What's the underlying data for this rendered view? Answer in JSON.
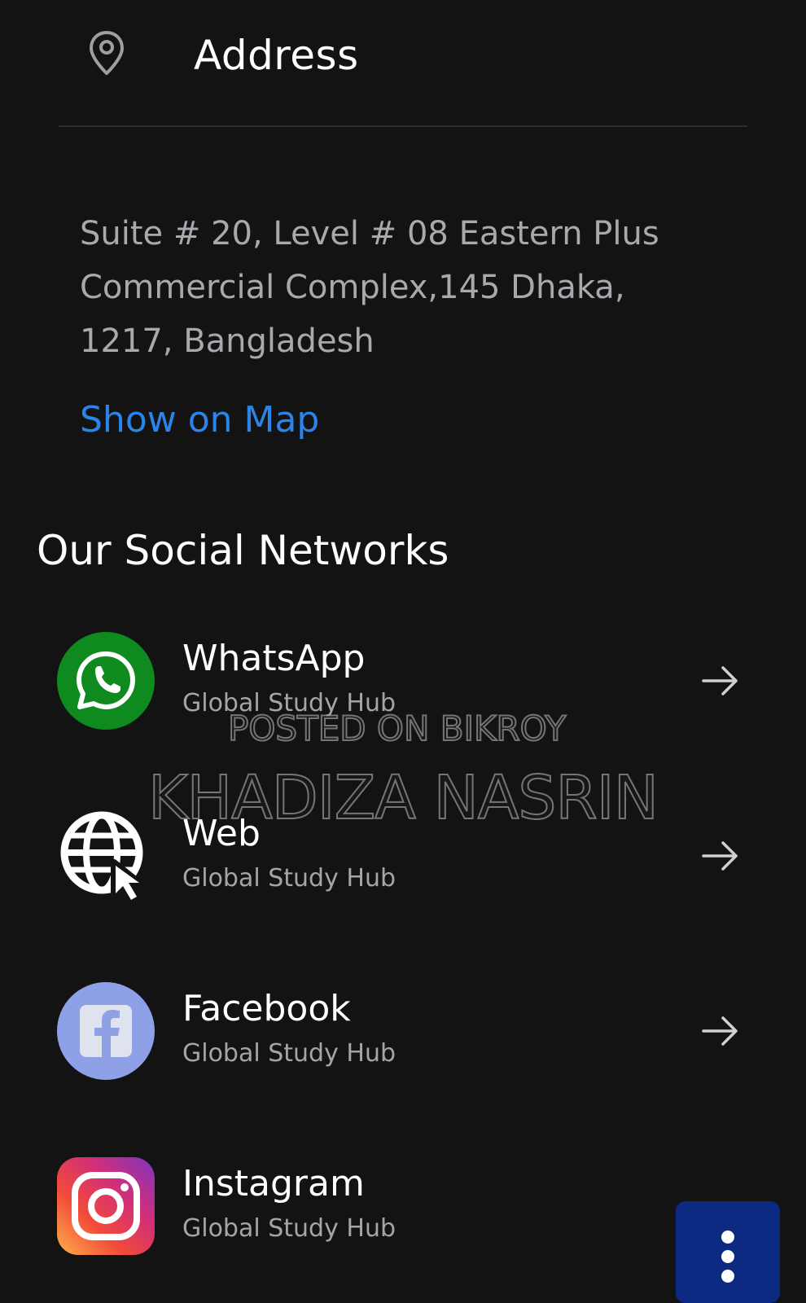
{
  "address": {
    "icon": "map-pin-icon",
    "title": "Address",
    "text": "Suite # 20, Level # 08 Eastern Plus Commercial Complex,145 Dhaka, 1217, Bangladesh",
    "map_link": "Show on Map",
    "link_color": "#2a84e9"
  },
  "social": {
    "title": "Our Social Networks",
    "items": [
      {
        "name": "WhatsApp",
        "subtitle": "Global Study Hub",
        "icon": "whatsapp-icon",
        "color": "#0f8a1f"
      },
      {
        "name": "Web",
        "subtitle": "Global Study Hub",
        "icon": "globe-cursor-icon",
        "color": "#ffffff"
      },
      {
        "name": "Facebook",
        "subtitle": "Global Study Hub",
        "icon": "facebook-icon",
        "color": "#8ea1e6"
      },
      {
        "name": "Instagram",
        "subtitle": "Global Study Hub",
        "icon": "instagram-icon",
        "color": "#e1306c"
      }
    ]
  },
  "watermark": {
    "line1": "POSTED ON BIKROY",
    "line2": "KHADIZA NASRIN"
  },
  "fab": {
    "icon": "more-vertical-icon",
    "color": "#0d2a82"
  }
}
